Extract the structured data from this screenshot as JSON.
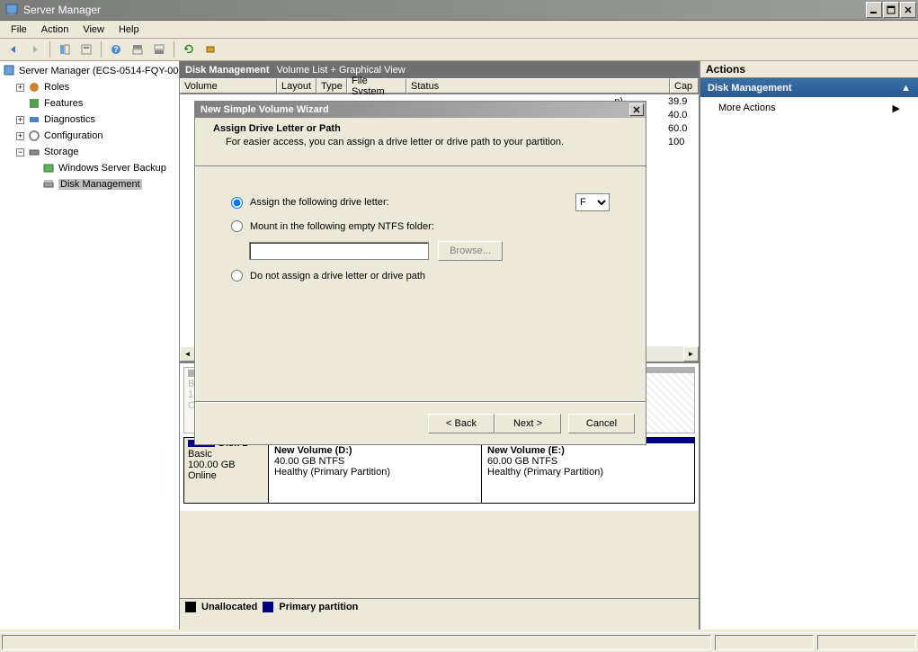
{
  "window": {
    "title": "Server Manager"
  },
  "menu": {
    "file": "File",
    "action": "Action",
    "view": "View",
    "help": "Help"
  },
  "tree": {
    "root": "Server Manager (ECS-0514-FQY-00",
    "roles": "Roles",
    "features": "Features",
    "diagnostics": "Diagnostics",
    "configuration": "Configuration",
    "storage": "Storage",
    "backup": "Windows Server Backup",
    "diskmgmt": "Disk Management"
  },
  "dm": {
    "title": "Disk Management",
    "subtitle": "Volume List + Graphical View"
  },
  "columns": {
    "volume": "Volume",
    "layout": "Layout",
    "type": "Type",
    "fs": "File System",
    "status": "Status",
    "cap": "Cap"
  },
  "gridRows": {
    "r0suffix": "n)",
    "caps": [
      "39.9",
      "40.0",
      "60.0",
      "100"
    ]
  },
  "disk1": {
    "name": "Disk 1",
    "kind": "Basic",
    "size": "100.00 GB",
    "state": "Online",
    "p1": {
      "title": "New Volume  (D:)",
      "l2": "40.00 GB NTFS",
      "l3": "Healthy (Primary Partition)"
    },
    "p2": {
      "title": "New Volume  (E:)",
      "l2": "60.00 GB NTFS",
      "l3": "Healthy (Primary Partition)"
    }
  },
  "legend": {
    "unalloc": "Unallocated",
    "primary": "Primary partition"
  },
  "actions": {
    "header": "Actions",
    "section": "Disk Management",
    "more": "More Actions"
  },
  "wizard": {
    "title": "New Simple Volume Wizard",
    "heading": "Assign Drive Letter or Path",
    "sub": "For easier access, you can assign a drive letter or drive path to your partition.",
    "opt1": "Assign the following drive letter:",
    "letter": "F",
    "opt2": "Mount in the following empty NTFS folder:",
    "browse": "Browse...",
    "opt3": "Do not assign a drive letter or drive path",
    "back": "< Back",
    "next": "Next >",
    "cancel": "Cancel"
  }
}
